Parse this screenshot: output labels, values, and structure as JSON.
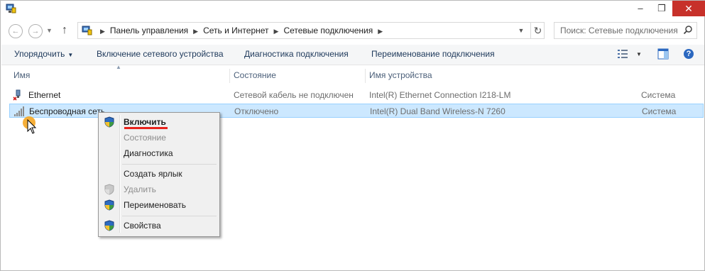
{
  "window": {
    "minimize": "–",
    "maximize": "❐",
    "close": "✕"
  },
  "nav": {
    "back": "←",
    "forward": "→",
    "up": "↑",
    "breadcrumbs": [
      "Панель управления",
      "Сеть и Интернет",
      "Сетевые подключения"
    ],
    "search_placeholder": "Поиск: Сетевые подключения"
  },
  "toolbar": {
    "organize": "Упорядочить",
    "enable_device": "Включение сетевого устройства",
    "diagnostics": "Диагностика подключения",
    "rename": "Переименование подключения",
    "help": "?"
  },
  "columns": {
    "name": "Имя",
    "status": "Состояние",
    "device": "Имя устройства"
  },
  "connections": [
    {
      "name": "Ethernet",
      "status": "Сетевой кабель не подключен",
      "device": "Intel(R) Ethernet Connection I218-LM",
      "owner": "Система"
    },
    {
      "name": "Беспроводная сеть",
      "status": "Отключено",
      "device": "Intel(R) Dual Band Wireless-N 7260",
      "owner": "Система",
      "selected": true
    }
  ],
  "context_menu": {
    "items": [
      {
        "label": "Включить",
        "shield": true,
        "bold": true,
        "enabled": true
      },
      {
        "label": "Состояние",
        "shield": false,
        "enabled": false
      },
      {
        "label": "Диагностика",
        "shield": false,
        "enabled": true
      },
      {
        "label": "Создать ярлык",
        "shield": false,
        "enabled": true
      },
      {
        "label": "Удалить",
        "shield": true,
        "enabled": false
      },
      {
        "label": "Переименовать",
        "shield": true,
        "enabled": true
      },
      {
        "label": "Свойства",
        "shield": true,
        "enabled": true
      }
    ]
  },
  "colors": {
    "selection": "#cce8ff",
    "highlight_underline": "#e8231c",
    "pointer_dot": "#f5a623",
    "close_button": "#c7312a"
  }
}
